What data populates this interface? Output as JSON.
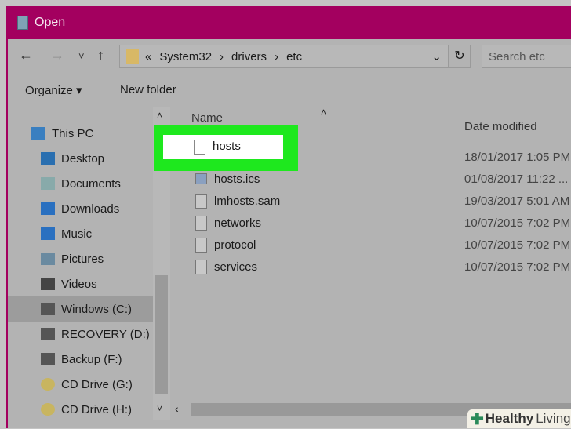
{
  "window": {
    "title": "Open",
    "accent": "#a3005f"
  },
  "nav": {
    "back": "←",
    "forward": "→",
    "recent": "˅",
    "up": "↑",
    "breadcrumb": [
      "«",
      "System32",
      "›",
      "drivers",
      "›",
      "etc"
    ],
    "dropdown": "⌄",
    "refresh": "↻",
    "search_placeholder": "Search etc"
  },
  "toolbar": {
    "organize": "Organize ▾",
    "new_folder": "New folder"
  },
  "sidebar": {
    "items": [
      {
        "label": "This PC",
        "icon": "computer-icon"
      },
      {
        "label": "Desktop",
        "icon": "desktop-icon"
      },
      {
        "label": "Documents",
        "icon": "documents-icon"
      },
      {
        "label": "Downloads",
        "icon": "downloads-icon"
      },
      {
        "label": "Music",
        "icon": "music-icon"
      },
      {
        "label": "Pictures",
        "icon": "pictures-icon"
      },
      {
        "label": "Videos",
        "icon": "videos-icon"
      },
      {
        "label": "Windows (C:)",
        "icon": "drive-icon",
        "selected": true
      },
      {
        "label": "RECOVERY (D:)",
        "icon": "drive-icon"
      },
      {
        "label": "Backup (F:)",
        "icon": "drive-icon"
      },
      {
        "label": "CD Drive (G:)",
        "icon": "cd-icon"
      },
      {
        "label": "CD Drive (H:)",
        "icon": "cd-icon"
      }
    ]
  },
  "list": {
    "columns": [
      "Name",
      "Date modified"
    ],
    "files": [
      {
        "name": "hosts",
        "date": "18/01/2017 1:05 PM",
        "highlighted": true
      },
      {
        "name": "hosts.ics",
        "date": "01/08/2017 11:22 ..."
      },
      {
        "name": "lmhosts.sam",
        "date": "19/03/2017 5:01 AM"
      },
      {
        "name": "networks",
        "date": "10/07/2015 7:02 PM"
      },
      {
        "name": "protocol",
        "date": "10/07/2015 7:02 PM"
      },
      {
        "name": "services",
        "date": "10/07/2015 7:02 PM"
      }
    ]
  },
  "watermark": {
    "text1": "Healthy",
    "text2": "Living"
  }
}
